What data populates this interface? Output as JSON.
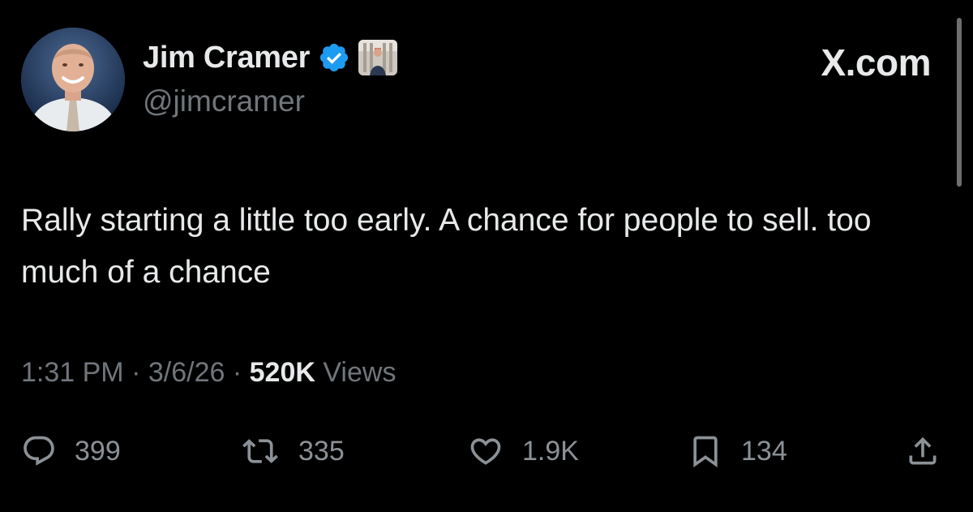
{
  "author": {
    "display_name": "Jim Cramer",
    "handle": "@jimcramer",
    "verified_icon": "verified-badge-icon",
    "affiliate_badge": "affiliate-badge-icon",
    "avatar": "avatar"
  },
  "site_label": "X.com",
  "tweet": {
    "text": "Rally starting a little too early. A chance for people to sell. too much of a chance"
  },
  "meta": {
    "time": "1:31 PM",
    "separator": "·",
    "date": "3/6/26",
    "views_count": "520K",
    "views_label": "Views"
  },
  "actions": {
    "replies": {
      "icon": "reply-icon",
      "count": "399"
    },
    "reposts": {
      "icon": "repost-icon",
      "count": "335"
    },
    "likes": {
      "icon": "heart-icon",
      "count": "1.9K"
    },
    "bookmarks": {
      "icon": "bookmark-icon",
      "count": "134"
    },
    "share": {
      "icon": "share-icon"
    }
  },
  "colors": {
    "background": "#000000",
    "primary_text": "#e7e9ea",
    "secondary_text": "#71767b",
    "verified_blue": "#1d9bf0"
  }
}
